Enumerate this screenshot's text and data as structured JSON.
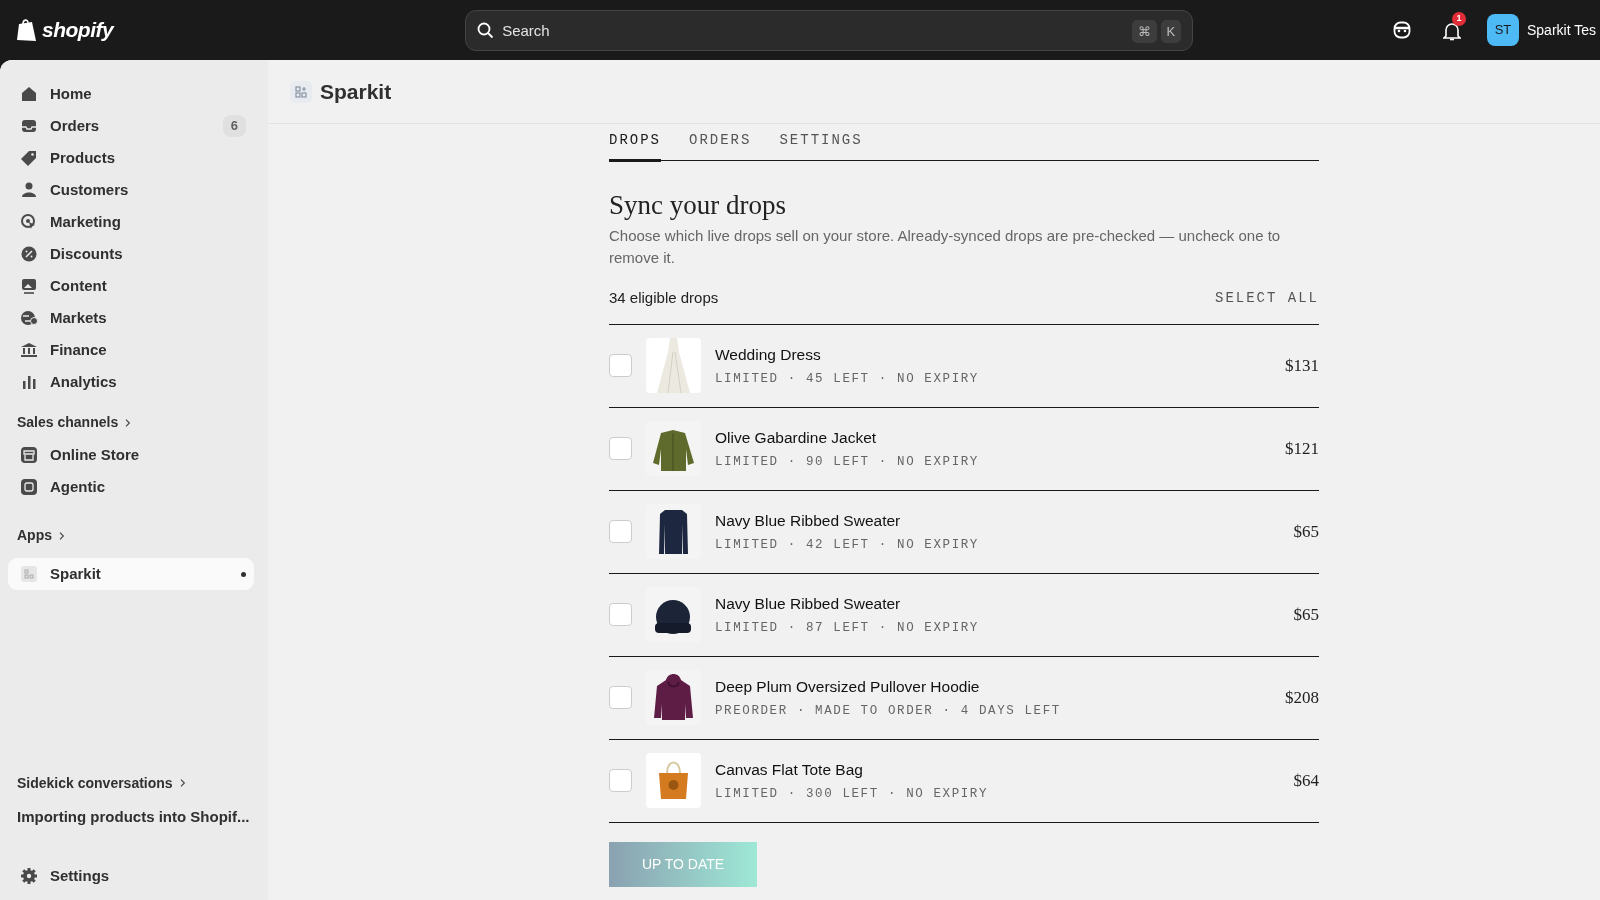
{
  "topbar": {
    "logo": "shopify",
    "search": {
      "placeholder": "Search"
    },
    "shortcut_keys": [
      "⌘",
      "K"
    ],
    "notification_count": "1",
    "avatar_initials": "ST",
    "store_name": "Sparkit Tes"
  },
  "sidebar": {
    "items": [
      {
        "label": "Home",
        "selected": false
      },
      {
        "label": "Orders",
        "badge": "6",
        "selected": false
      },
      {
        "label": "Products",
        "selected": false
      },
      {
        "label": "Customers",
        "selected": false
      },
      {
        "label": "Marketing",
        "selected": false
      },
      {
        "label": "Discounts",
        "selected": false
      },
      {
        "label": "Content",
        "selected": false
      },
      {
        "label": "Markets",
        "selected": false
      },
      {
        "label": "Finance",
        "selected": false
      },
      {
        "label": "Analytics",
        "selected": false
      }
    ],
    "sales_channels": {
      "label": "Sales channels",
      "items": [
        {
          "label": "Online Store",
          "selected": false
        },
        {
          "label": "Agentic",
          "selected": false
        }
      ]
    },
    "apps": {
      "label": "Apps",
      "items": [
        {
          "label": "Sparkit",
          "selected": true
        }
      ]
    },
    "sidekick": {
      "label": "Sidekick conversations",
      "items": [
        "Importing products into Shopif..."
      ]
    },
    "settings": "Settings"
  },
  "page": {
    "title": "Sparkit",
    "tabs": [
      {
        "label": "DROPS",
        "selected": true
      },
      {
        "label": "ORDERS",
        "selected": false
      },
      {
        "label": "SETTINGS",
        "selected": false
      }
    ],
    "heading": "Sync your drops",
    "description": "Choose which live drops sell on your store. Already-synced drops are pre-checked — uncheck one to remove it.",
    "count": "34 eligible drops",
    "select_all": "SELECT ALL",
    "drops": [
      {
        "name": "Wedding Dress",
        "meta": "LIMITED · 45 LEFT · NO EXPIRY",
        "price": "$131",
        "checked": false
      },
      {
        "name": "Olive Gabardine Jacket",
        "meta": "LIMITED · 90 LEFT · NO EXPIRY",
        "price": "$121",
        "checked": false
      },
      {
        "name": "Navy Blue Ribbed Sweater",
        "meta": "LIMITED · 42 LEFT · NO EXPIRY",
        "price": "$65",
        "checked": false
      },
      {
        "name": "Navy Blue Ribbed Sweater",
        "meta": "LIMITED · 87 LEFT · NO EXPIRY",
        "price": "$65",
        "checked": false
      },
      {
        "name": "Deep Plum Oversized Pullover Hoodie",
        "meta": "PREORDER · MADE TO ORDER · 4 DAYS LEFT",
        "price": "$208",
        "checked": false
      },
      {
        "name": "Canvas Flat Tote Bag",
        "meta": "LIMITED · 300 LEFT · NO EXPIRY",
        "price": "$64",
        "checked": false
      }
    ],
    "button": "UP TO DATE"
  }
}
